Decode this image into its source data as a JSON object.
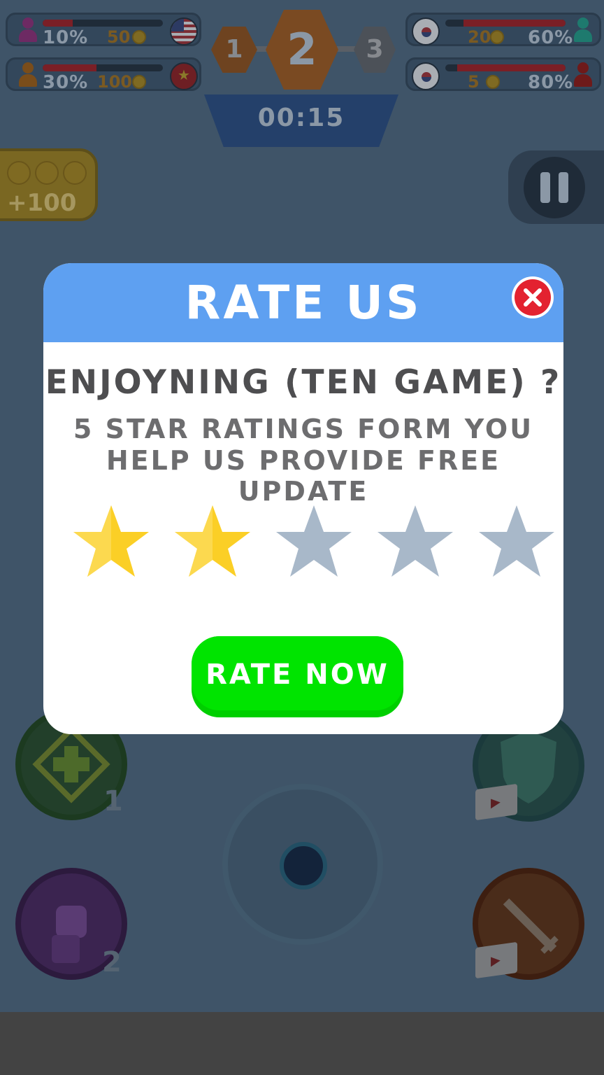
{
  "players_left": [
    {
      "percent": "10%",
      "coins": "50",
      "avatar_color": "#6d2a63",
      "flag": "us-flag-icon",
      "health": 0.25
    },
    {
      "percent": "30%",
      "coins": "100",
      "avatar_color": "#7a4d1a",
      "flag": "vietnam-flag-icon",
      "health": 0.45
    }
  ],
  "players_right": [
    {
      "percent": "60%",
      "coins": "20",
      "avatar_color": "#1e7a6e",
      "flag": "south-korea-flag-icon",
      "health": 0.85
    },
    {
      "percent": "80%",
      "coins": "5",
      "avatar_color": "#6e1a1a",
      "flag": "south-korea-flag-icon",
      "health": 0.9
    }
  ],
  "stage": {
    "steps": [
      "1",
      "2",
      "3"
    ],
    "current": "2",
    "timer": "00:15"
  },
  "coin_reward": {
    "label": "+100"
  },
  "abilities": {
    "heal_count": "1",
    "power_count": "2"
  },
  "modal": {
    "title": "RATE US",
    "question": "ENJOYNING (TEN GAME) ?",
    "subtitle_line1": "5 STAR RATINGS FORM YOU",
    "subtitle_line2": "HELP US PROVIDE FREE UPDATE",
    "stars_total": 5,
    "stars_selected": 2,
    "rate_button_label": "RATE NOW"
  },
  "colors": {
    "header_blue": "#5ea0f1",
    "star_gold": "#fbcf26",
    "star_gray": "#a8b8c9",
    "button_green": "#00e400",
    "close_red": "#e32230"
  }
}
